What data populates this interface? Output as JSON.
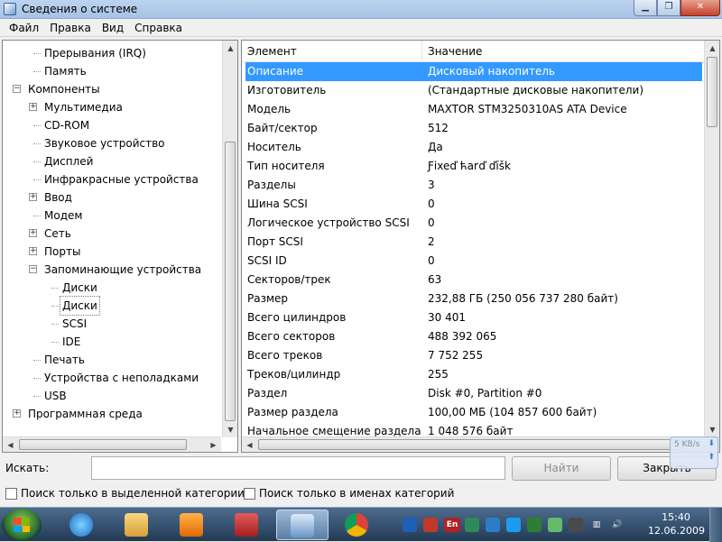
{
  "window": {
    "title": "Сведения о системе"
  },
  "menu": [
    "Файл",
    "Правка",
    "Вид",
    "Справка"
  ],
  "tree": {
    "items": [
      {
        "label": "Прерывания (IRQ)",
        "level": 2,
        "box": ""
      },
      {
        "label": "Память",
        "level": 2,
        "box": ""
      },
      {
        "label": "Компоненты",
        "level": 1,
        "box": "−"
      },
      {
        "label": "Мультимедиа",
        "level": 2,
        "box": "+"
      },
      {
        "label": "CD-ROM",
        "level": 2,
        "box": ""
      },
      {
        "label": "Звуковое устройство",
        "level": 2,
        "box": ""
      },
      {
        "label": "Дисплей",
        "level": 2,
        "box": ""
      },
      {
        "label": "Инфракрасные устройства",
        "level": 2,
        "box": ""
      },
      {
        "label": "Ввод",
        "level": 2,
        "box": "+"
      },
      {
        "label": "Модем",
        "level": 2,
        "box": ""
      },
      {
        "label": "Сеть",
        "level": 2,
        "box": "+"
      },
      {
        "label": "Порты",
        "level": 2,
        "box": "+"
      },
      {
        "label": "Запоминающие устройства",
        "level": 2,
        "box": "−"
      },
      {
        "label": "Диски",
        "level": 3,
        "box": ""
      },
      {
        "label": "Диски",
        "level": 3,
        "box": "",
        "selected": true
      },
      {
        "label": "SCSI",
        "level": 3,
        "box": ""
      },
      {
        "label": "IDE",
        "level": 3,
        "box": ""
      },
      {
        "label": "Печать",
        "level": 2,
        "box": ""
      },
      {
        "label": "Устройства с неполадками",
        "level": 2,
        "box": ""
      },
      {
        "label": "USB",
        "level": 2,
        "box": ""
      },
      {
        "label": "Программная среда",
        "level": 1,
        "box": "+"
      }
    ]
  },
  "list": {
    "columns": [
      "Элемент",
      "Значение"
    ],
    "rows": [
      [
        "Описание",
        "Дисковый накопитель"
      ],
      [
        "Изготовитель",
        "(Стандартные дисковые накопители)"
      ],
      [
        "Модель",
        "MAXTOR STM3250310AS ATA Device"
      ],
      [
        "Байт/сектор",
        "512"
      ],
      [
        "Носитель",
        "Да"
      ],
      [
        "Тип носителя",
        "Ƒixeď ћarď ďīšk"
      ],
      [
        "Разделы",
        "3"
      ],
      [
        "Шина SCSI",
        "0"
      ],
      [
        "Логическое устройство SCSI",
        "0"
      ],
      [
        "Порт SCSI",
        "2"
      ],
      [
        "SCSI ID",
        "0"
      ],
      [
        "Секторов/трек",
        "63"
      ],
      [
        "Размер",
        "232,88 ГБ (250 056 737 280 байт)"
      ],
      [
        "Всего цилиндров",
        "30 401"
      ],
      [
        "Всего секторов",
        "488 392 065"
      ],
      [
        "Всего треков",
        "7 752 255"
      ],
      [
        "Треков/цилиндр",
        "255"
      ],
      [
        "Раздел",
        "Disk #0, Partition #0"
      ],
      [
        "Размер раздела",
        "100,00 МБ (104 857 600 байт)"
      ],
      [
        "Начальное смещение раздела",
        "1 048 576 байт"
      ]
    ],
    "selected_index": 0
  },
  "search": {
    "label": "Искать:",
    "value": "",
    "find_button": "Найти",
    "close_button": "Закрыть",
    "check1": "Поиск только в выделенной категории",
    "check2": "Поиск только в именах категорий"
  },
  "net_widget": {
    "text": "5 KB/s"
  },
  "taskbar": {
    "items": [
      "internet-explorer-icon",
      "explorer-icon",
      "media-player-icon",
      "app-red-icon",
      "system-info-icon",
      "chrome-icon"
    ],
    "active_index": 4
  },
  "tray": {
    "icons": [
      "t-icon",
      "red-app-icon",
      "en-language-icon",
      "green-circle-icon",
      "blue-app-icon",
      "globe-icon",
      "shield-icon",
      "clover-icon",
      "flag-icon",
      "network-icon",
      "volume-icon"
    ],
    "language": "En",
    "time": "15:40",
    "date": "12.06.2009"
  },
  "colors": {
    "selection": "#3399FF",
    "taskbar": "#2E4A6A"
  }
}
